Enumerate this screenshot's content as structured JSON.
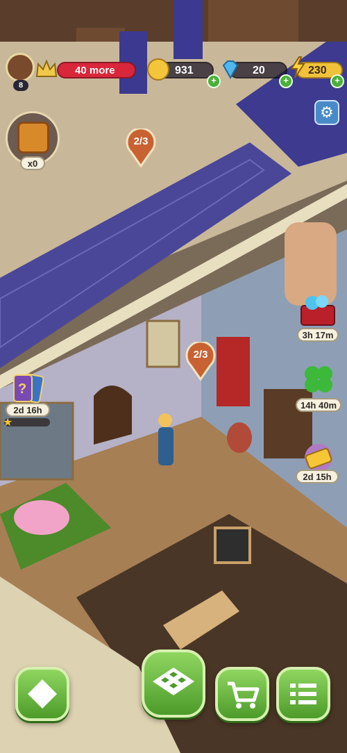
{
  "hud": {
    "level": "8",
    "progress_text": "40 more",
    "coins": "931",
    "gems": "20",
    "energy": "230"
  },
  "gift": {
    "count": "x0"
  },
  "markers": [
    {
      "text": "2/3"
    },
    {
      "text": "2/3"
    }
  ],
  "events": {
    "chest_timer": "3h 17m",
    "cards_timer": "2d 16h",
    "clover_timer": "14h 40m",
    "ticket_timer": "2d 15h"
  },
  "colors": {
    "accent_green": "#5fb236",
    "carpet_purple": "#3f3a8a",
    "hud_red": "#d8263a",
    "energy_yellow": "#f7c62a"
  },
  "icons": [
    "avatar",
    "crown-icon",
    "coin-icon",
    "gem-icon",
    "lightning-icon",
    "gear-icon",
    "gift-icon",
    "rotate-icon",
    "checkerboard-icon",
    "cart-icon",
    "list-icon"
  ]
}
